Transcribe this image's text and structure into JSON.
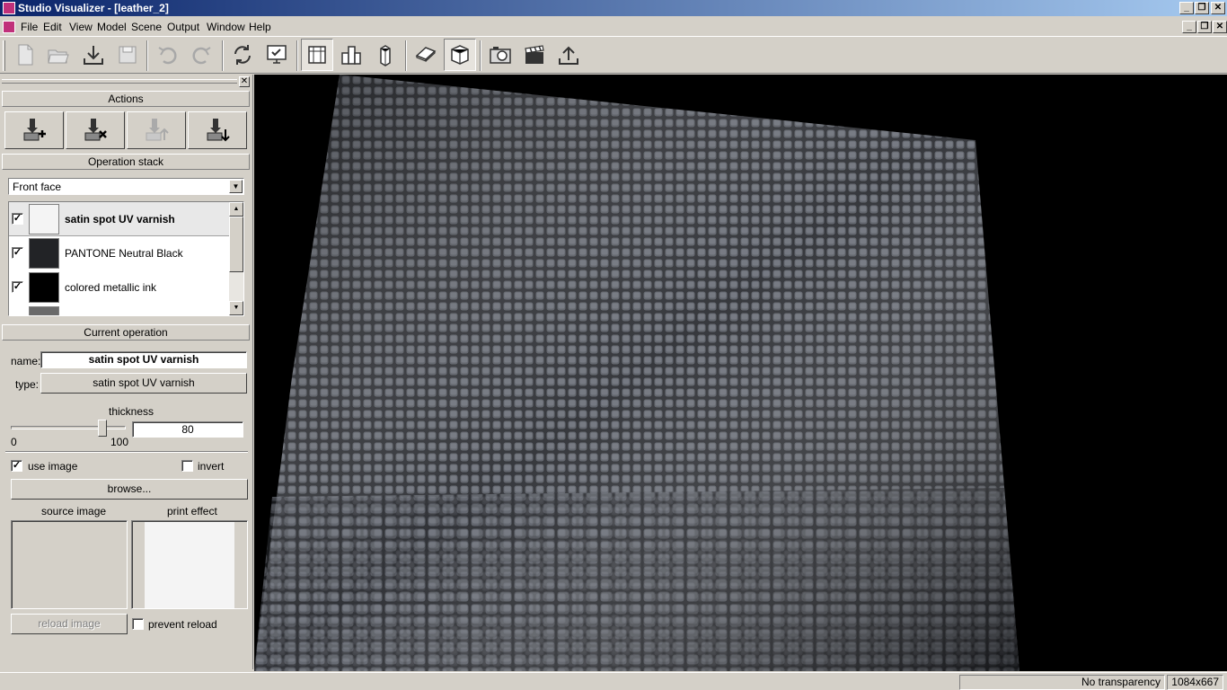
{
  "window": {
    "title": "Studio Visualizer - [leather_2]",
    "controls": {
      "minimize": "_",
      "restore": "❐",
      "close": "✕"
    }
  },
  "menu": {
    "items": [
      "File",
      "Edit",
      "View",
      "Model",
      "Scene",
      "Output",
      "Window",
      "Help"
    ]
  },
  "toolbar": {
    "buttons": [
      {
        "name": "new-icon",
        "enabled": false
      },
      {
        "name": "open-icon",
        "enabled": false
      },
      {
        "name": "import-icon",
        "enabled": true
      },
      {
        "name": "save-icon",
        "enabled": false
      },
      {
        "name": "undo-icon",
        "enabled": false
      },
      {
        "name": "redo-icon",
        "enabled": false
      },
      {
        "name": "refresh-icon",
        "enabled": true
      },
      {
        "name": "render-check-icon",
        "enabled": true
      },
      {
        "name": "flat-view-icon",
        "enabled": true,
        "pressed": true
      },
      {
        "name": "box-view-icon",
        "enabled": true
      },
      {
        "name": "tall-box-view-icon",
        "enabled": true
      },
      {
        "name": "card-model-icon",
        "enabled": true
      },
      {
        "name": "cube-model-icon",
        "enabled": true,
        "pressed": true
      },
      {
        "name": "camera-icon",
        "enabled": true
      },
      {
        "name": "clapperboard-icon",
        "enabled": true
      },
      {
        "name": "export-icon",
        "enabled": true
      }
    ]
  },
  "panel": {
    "close_label": "✕",
    "actions_header": "Actions",
    "action_buttons": [
      {
        "name": "add-operation-icon",
        "enabled": true
      },
      {
        "name": "remove-operation-icon",
        "enabled": true
      },
      {
        "name": "move-up-operation-icon",
        "enabled": false
      },
      {
        "name": "move-down-operation-icon",
        "enabled": true
      }
    ],
    "operation_stack_header": "Operation stack",
    "face_select": "Front face",
    "operations": [
      {
        "label": "satin spot UV varnish",
        "checked": true,
        "swatch": "#f4f4f4",
        "selected": true
      },
      {
        "label": "PANTONE Neutral Black",
        "checked": true,
        "swatch": "#222326",
        "selected": false
      },
      {
        "label": "colored metallic ink",
        "checked": true,
        "swatch": "#000000",
        "selected": false
      }
    ],
    "current_operation_header": "Current operation",
    "name_label": "name:",
    "name_value": "satin spot UV varnish",
    "type_label": "type:",
    "type_value": "satin spot UV varnish",
    "thickness_label": "thickness",
    "thickness_min": "0",
    "thickness_max": "100",
    "thickness_value": "80",
    "thickness_level": 0.8,
    "use_image_label": "use image",
    "use_image_checked": true,
    "invert_label": "invert",
    "invert_checked": false,
    "browse_label": "browse...",
    "source_image_label": "source image",
    "print_effect_label": "print effect",
    "reload_label": "reload image",
    "prevent_reload_label": "prevent reload",
    "prevent_reload_checked": false
  },
  "status": {
    "transparency": "No transparency",
    "resolution": "1084x667"
  },
  "colors": {
    "title_gradient_start": "#0a246a",
    "title_gradient_end": "#a6caf0",
    "chrome": "#d4d0c8",
    "viewport_bg": "#000000",
    "leather": "#3c3f46"
  }
}
